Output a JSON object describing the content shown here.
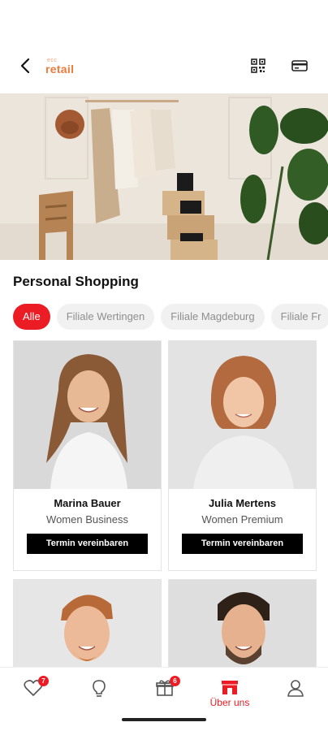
{
  "header": {
    "logo_sup": "ecc",
    "logo_main": "retail",
    "icons": {
      "back": "chevron-left-icon",
      "qr": "qr-code-icon",
      "card": "card-icon"
    }
  },
  "section": {
    "title": "Personal Shopping"
  },
  "filters": [
    {
      "label": "Alle",
      "active": true
    },
    {
      "label": "Filiale Wertingen",
      "active": false
    },
    {
      "label": "Filiale Magdeburg",
      "active": false
    },
    {
      "label": "Filiale Fr",
      "active": false
    }
  ],
  "consultants": [
    {
      "name": "Marina Bauer",
      "role": "Women Business",
      "cta": "Termin vereinbaren"
    },
    {
      "name": "Julia Mertens",
      "role": "Women Premium",
      "cta": "Termin vereinbaren"
    },
    {
      "name": "",
      "role": "",
      "cta": ""
    },
    {
      "name": "",
      "role": "",
      "cta": ""
    }
  ],
  "tabbar": {
    "wishlist_badge": "7",
    "gifts_badge": "6",
    "about_label": "Über uns"
  },
  "colors": {
    "accent": "#ec1c24",
    "logo": "#f07a3c",
    "cta": "#000000"
  }
}
